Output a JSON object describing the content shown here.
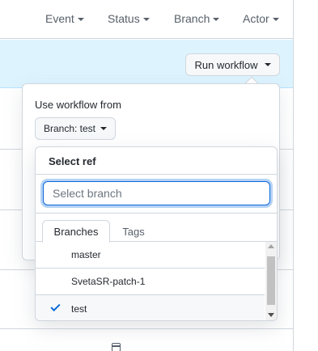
{
  "filters": {
    "event": "Event",
    "status": "Status",
    "branch": "Branch",
    "actor": "Actor"
  },
  "banner": {
    "run_workflow_label": "Run workflow"
  },
  "workflow_dropdown": {
    "use_from_label": "Use workflow from",
    "branch_button_label": "Branch: test"
  },
  "select_ref": {
    "title": "Select ref",
    "filter_placeholder": "Select branch",
    "filter_value": "",
    "tabs": [
      {
        "label": "Branches",
        "active": true
      },
      {
        "label": "Tags",
        "active": false
      }
    ],
    "items": [
      {
        "label": "master",
        "selected": false
      },
      {
        "label": "SvetaSR-patch-1",
        "selected": false
      },
      {
        "label": "test",
        "selected": true
      }
    ]
  },
  "icons": {
    "filter_caret": "chevron-down-icon",
    "selected_mark": "check-icon",
    "footer": "calendar-icon"
  },
  "colors": {
    "banner_bg": "#ddf4ff",
    "focus_border": "#0969da",
    "check": "#0969da"
  }
}
